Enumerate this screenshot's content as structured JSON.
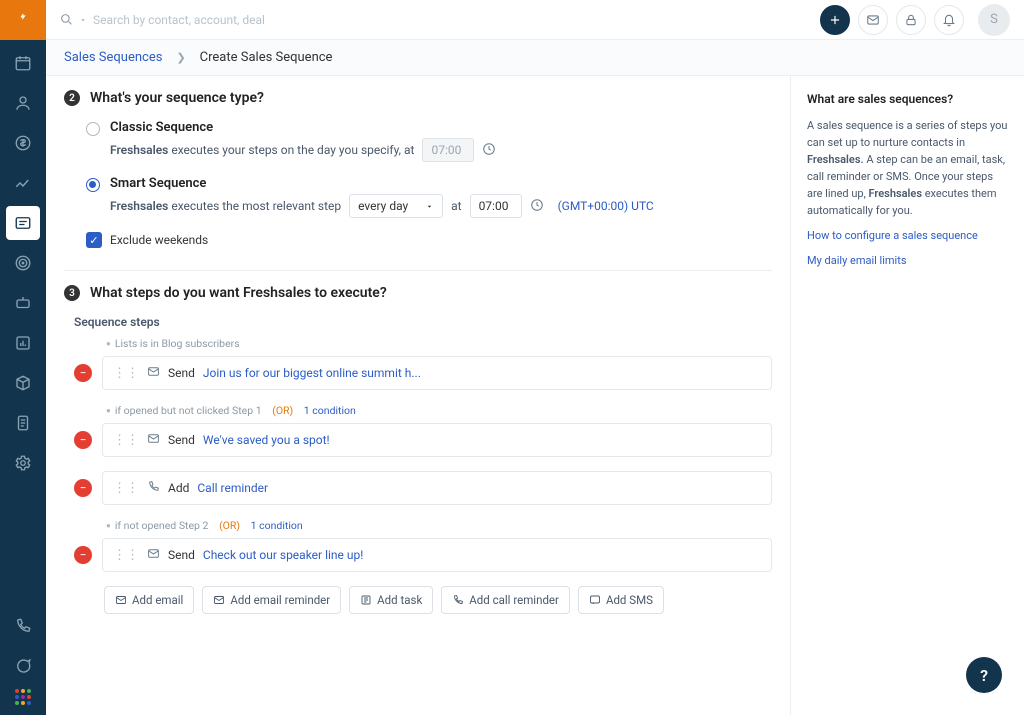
{
  "search": {
    "placeholder": "Search by contact, account, deal"
  },
  "breadcrumb": {
    "root": "Sales Sequences",
    "current": "Create Sales Sequence"
  },
  "section2": {
    "title": "What's your sequence type?",
    "classic": {
      "title": "Classic Sequence",
      "desc_prefix": "Freshsales",
      "desc_text": "executes your steps on the day you specify, at",
      "time": "07:00"
    },
    "smart": {
      "title": "Smart Sequence",
      "desc_prefix": "Freshsales",
      "desc_text": "executes the most relevant step",
      "freq": "every day",
      "at": "at",
      "time": "07:00",
      "tz": "(GMT+00:00) UTC"
    },
    "exclude": "Exclude weekends"
  },
  "section3": {
    "title": "What steps do you want Freshsales to execute?",
    "subhead": "Sequence steps",
    "cond1": "Lists is in Blog subscribers",
    "step1_prefix": "Send",
    "step1_link": "Join us for our biggest online summit h...",
    "cond2_text": "if opened but not clicked Step 1",
    "cond_or": "(OR)",
    "cond_1c": "1 condition",
    "step2_prefix": "Send",
    "step2_link": "We've saved you a spot!",
    "step3_prefix": "Add",
    "step3_link": "Call reminder",
    "cond3_text": "if not opened Step 2",
    "step4_prefix": "Send",
    "step4_link": "Check out our speaker line up!"
  },
  "addbtns": {
    "email": "Add email",
    "email_reminder": "Add email reminder",
    "task": "Add task",
    "call_reminder": "Add call reminder",
    "sms": "Add SMS"
  },
  "rightpanel": {
    "title": "What are sales sequences?",
    "body_1": "A sales sequence is a series of steps you can set up to nurture contacts in ",
    "body_bold1": "Freshsales.",
    "body_2": " A step can be an email, task, call reminder or SMS. Once your steps are lined up, ",
    "body_bold2": "Freshsales",
    "body_3": " executes them automatically for you.",
    "link1": "How to configure a sales sequence",
    "link2": "My daily email limits"
  },
  "avatar_letter": "S"
}
